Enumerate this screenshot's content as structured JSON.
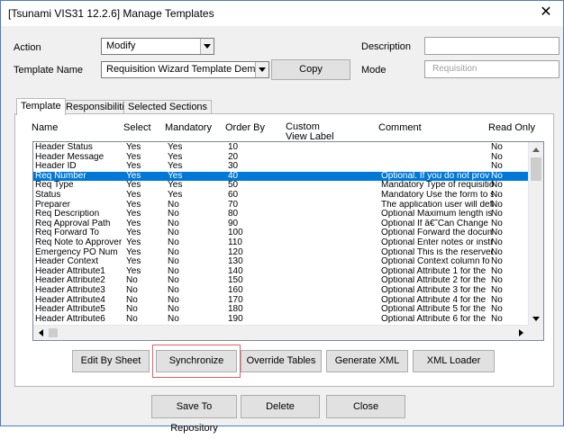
{
  "window": {
    "title": "[Tsunami VIS31 12.2.6] Manage Templates",
    "close_glyph": "✕"
  },
  "form": {
    "action_label": "Action",
    "action_value": "Modify",
    "template_name_label": "Template Name",
    "template_name_value": "Requisition Wizard Template Demo",
    "copy_button": "Copy",
    "description_label": "Description",
    "description_value": "",
    "mode_label": "Mode",
    "mode_value": "Requisition"
  },
  "tabs": [
    {
      "label": "Template",
      "active": true
    },
    {
      "label": "Responsibilities",
      "active": false
    },
    {
      "label": "Selected Sections",
      "active": false
    }
  ],
  "grid": {
    "headers": {
      "name": "Name",
      "select": "Select",
      "mandatory": "Mandatory",
      "order_by": "Order By",
      "custom_view_label_1": "Custom",
      "custom_view_label_2": "View Label",
      "comment": "Comment",
      "read_only": "Read Only"
    },
    "selected_row_index": 3,
    "rows": [
      {
        "name": "Header Status",
        "select": "Yes",
        "mandatory": "Yes",
        "order": "10",
        "custom": "",
        "comment": "",
        "read_only": "No"
      },
      {
        "name": "Header Message",
        "select": "Yes",
        "mandatory": "Yes",
        "order": "20",
        "custom": "",
        "comment": "",
        "read_only": "No"
      },
      {
        "name": "Header ID",
        "select": "Yes",
        "mandatory": "Yes",
        "order": "30",
        "custom": "",
        "comment": "",
        "read_only": "No"
      },
      {
        "name": "Req Number",
        "select": "Yes",
        "mandatory": "Yes",
        "order": "40",
        "custom": "",
        "comment": "Optional.  If you do not prov",
        "read_only": "No"
      },
      {
        "name": "Req Type",
        "select": "Yes",
        "mandatory": "Yes",
        "order": "50",
        "custom": "",
        "comment": "Mandatory Type of requisitio",
        "read_only": "No"
      },
      {
        "name": "Status",
        "select": "Yes",
        "mandatory": "Yes",
        "order": "60",
        "custom": "",
        "comment": "Mandatory Use the form to s",
        "read_only": "No"
      },
      {
        "name": "Preparer",
        "select": "Yes",
        "mandatory": "No",
        "order": "70",
        "custom": "",
        "comment": "The application user will defa",
        "read_only": "No"
      },
      {
        "name": "Req Description",
        "select": "Yes",
        "mandatory": "No",
        "order": "80",
        "custom": "",
        "comment": "Optional  Maximum length is",
        "read_only": "No"
      },
      {
        "name": "Req Approval Path",
        "select": "Yes",
        "mandatory": "No",
        "order": "90",
        "custom": "",
        "comment": "Optional  If â€˜Can Change",
        "read_only": "No"
      },
      {
        "name": "Req Forward To",
        "select": "Yes",
        "mandatory": "No",
        "order": "100",
        "custom": "",
        "comment": "Optional  Forward the docum",
        "read_only": "No"
      },
      {
        "name": "Req Note to Approver",
        "select": "Yes",
        "mandatory": "No",
        "order": "110",
        "custom": "",
        "comment": "Optional Enter notes or instru",
        "read_only": "No"
      },
      {
        "name": "Emergency PO Num",
        "select": "Yes",
        "mandatory": "No",
        "order": "120",
        "custom": "",
        "comment": "Optional  This is the reserved",
        "read_only": "No"
      },
      {
        "name": "Header Context",
        "select": "Yes",
        "mandatory": "No",
        "order": "130",
        "custom": "",
        "comment": "Optional  Context  column fo",
        "read_only": "No"
      },
      {
        "name": "Header Attribute1",
        "select": "Yes",
        "mandatory": "No",
        "order": "140",
        "custom": "",
        "comment": "Optional   Attribute 1 for the",
        "read_only": "No"
      },
      {
        "name": "Header Attribute2",
        "select": "No",
        "mandatory": "No",
        "order": "150",
        "custom": "",
        "comment": "Optional   Attribute 2 for the",
        "read_only": "No"
      },
      {
        "name": "Header Attribute3",
        "select": "No",
        "mandatory": "No",
        "order": "160",
        "custom": "",
        "comment": "Optional   Attribute 3 for the",
        "read_only": "No"
      },
      {
        "name": "Header Attribute4",
        "select": "No",
        "mandatory": "No",
        "order": "170",
        "custom": "",
        "comment": "Optional   Attribute 4 for the",
        "read_only": "No"
      },
      {
        "name": "Header Attribute5",
        "select": "No",
        "mandatory": "No",
        "order": "180",
        "custom": "",
        "comment": "Optional   Attribute 5 for the",
        "read_only": "No"
      },
      {
        "name": "Header Attribute6",
        "select": "No",
        "mandatory": "No",
        "order": "190",
        "custom": "",
        "comment": "Optional   Attribute 6 for the",
        "read_only": "No"
      }
    ]
  },
  "buttons": {
    "edit_by_sheet": "Edit By Sheet",
    "synchronize": "Synchronize",
    "override_tables": "Override Tables",
    "generate_xml": "Generate XML",
    "xml_loader": "XML Loader",
    "save_to_repository": "Save To Repository",
    "delete": "Delete",
    "close": "Close"
  },
  "colors": {
    "selection": "#0078d7",
    "highlight_box": "#e06060",
    "window_border": "#4a7cc9"
  }
}
